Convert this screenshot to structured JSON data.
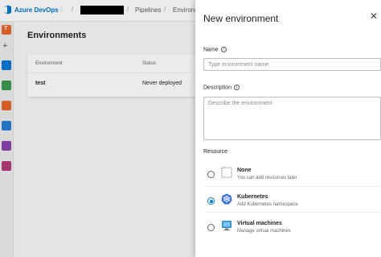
{
  "header": {
    "brand": "Azure DevOps",
    "crumb_pipelines": "Pipelines",
    "crumb_environments": "Environm"
  },
  "main": {
    "title": "Environments",
    "table": {
      "columns": [
        "Environment",
        "Status"
      ],
      "rows": [
        {
          "name": "test",
          "status": "Never deployed"
        }
      ]
    }
  },
  "panel": {
    "title": "New environment",
    "close_icon": "close-icon",
    "name_label": "Name",
    "name_placeholder": "Type environment name",
    "description_label": "Description",
    "description_placeholder": "Describe the environment",
    "resource_label": "Resource",
    "resources": [
      {
        "title": "None",
        "subtitle": "You can add resources later",
        "selected": false,
        "icon": "empty-box-icon"
      },
      {
        "title": "Kubernetes",
        "subtitle": "Add Kubernetes namespace",
        "selected": true,
        "icon": "kubernetes-icon"
      },
      {
        "title": "Virtual machines",
        "subtitle": "Manage virtual machines",
        "selected": false,
        "icon": "virtual-machine-icon"
      }
    ]
  },
  "colors": {
    "accent": "#0078d4"
  }
}
